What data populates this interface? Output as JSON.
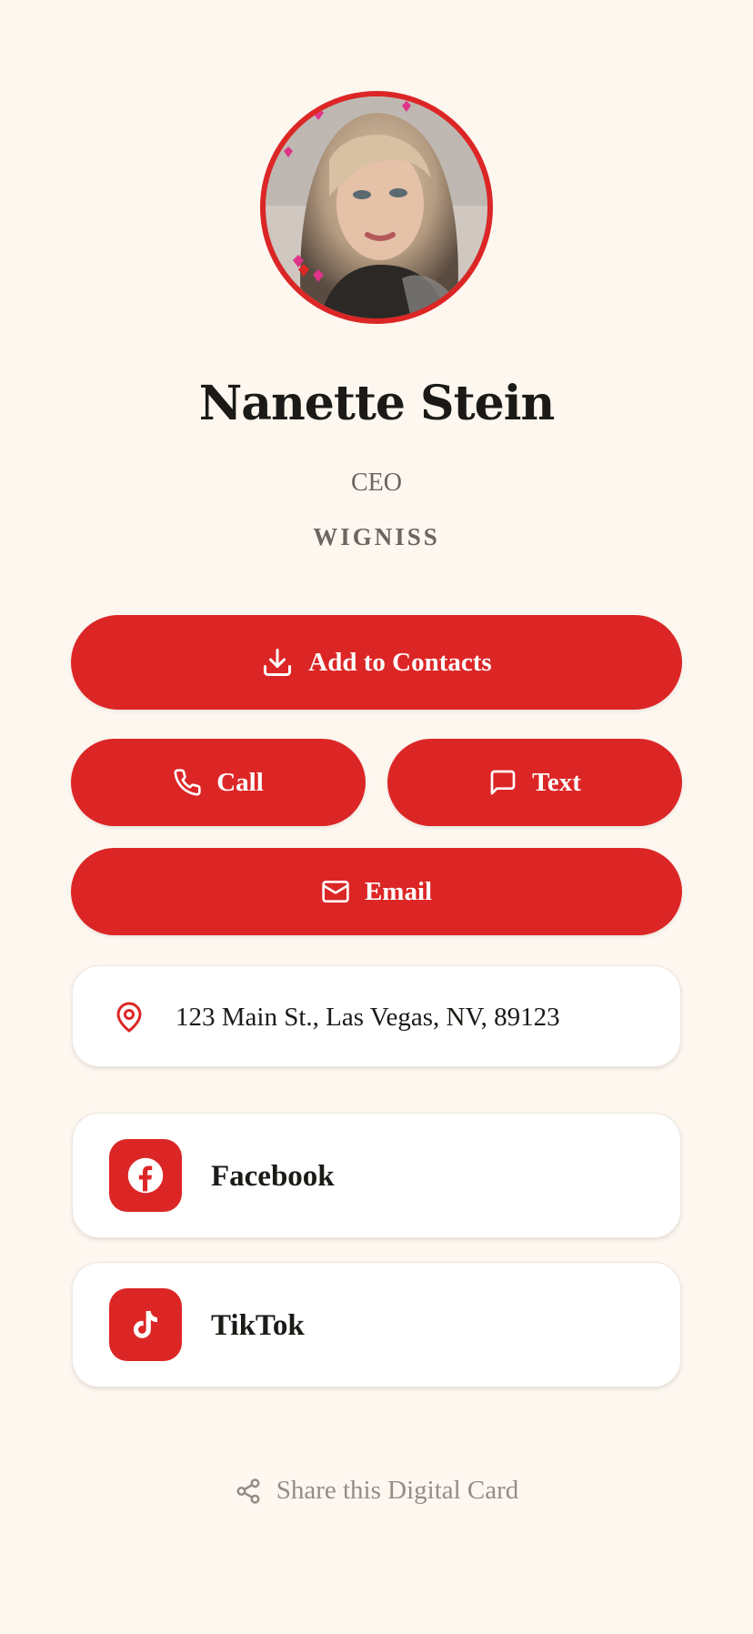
{
  "profile": {
    "name": "Nanette Stein",
    "title": "CEO",
    "company": "WIGNISS",
    "avatar_alt": "profile-photo"
  },
  "actions": {
    "add_contacts_label": "Add to Contacts",
    "call_label": "Call",
    "text_label": "Text",
    "email_label": "Email"
  },
  "address": {
    "text": "123 Main St., Las Vegas, NV, 89123",
    "icon": "map-pin-icon"
  },
  "social": [
    {
      "label": "Facebook",
      "icon": "facebook-icon"
    },
    {
      "label": "TikTok",
      "icon": "tiktok-icon"
    }
  ],
  "footer": {
    "share_label": "Share this Digital Card",
    "icon": "share-icon"
  },
  "colors": {
    "accent": "#dc2626",
    "background": "#fdf7f0",
    "card": "#ffffff",
    "muted_text": "#6b655d",
    "footer_text": "#948d85"
  }
}
